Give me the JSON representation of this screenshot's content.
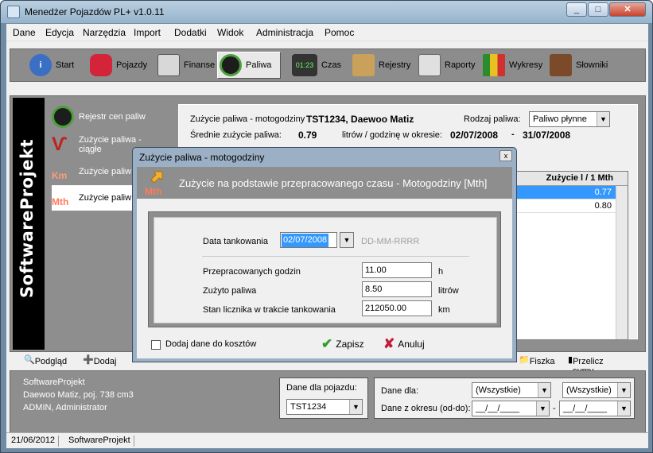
{
  "window": {
    "title": "Menedżer Pojazdów PL+  v1.0.11"
  },
  "menu": [
    "Dane",
    "Edycja",
    "Narzędzia",
    "Import",
    "Dodatki",
    "Widok",
    "Administracja",
    "Pomoc"
  ],
  "toolbar": [
    "Start",
    "Pojazdy",
    "Finanse",
    "Paliwa",
    "Czas",
    "Rejestry",
    "Raporty",
    "Wykresy",
    "Słowniki"
  ],
  "brand": "SoftwareProjekt",
  "subnav": [
    "Rejestr cen paliw",
    "Zużycie paliwa - ciągłe",
    "Zużycie paliw",
    "Zużycie paliw"
  ],
  "subnav_badges": {
    "km": "Km",
    "mth": "Mth"
  },
  "panel": {
    "title_prefix": "Zużycie paliwa - motogodziny",
    "vehicle": "TST1234, Daewoo Matiz",
    "fuel_kind_label": "Rodzaj paliwa:",
    "fuel_kind_value": "Paliwo płynne",
    "avg_label": "Średnie zużycie paliwa:",
    "avg_value": "0.79",
    "avg_unit": "litrów / godzinę  w okresie:",
    "date_from": "02/07/2008",
    "dash": "-",
    "date_to": "31/07/2008"
  },
  "grid": {
    "header": "Zużycie l / 1 Mth",
    "rows": [
      "0.77",
      "0.80"
    ]
  },
  "bottom_toolbar": {
    "preview": "Podgląd",
    "add": "Dodaj",
    "card": "Fiszka",
    "recalc": "Przelicz sumy"
  },
  "info": {
    "company": "SoftwareProjekt",
    "vehicle": "Daewoo Matiz, poj. 738 cm3",
    "user": "ADMIN, Administrator",
    "vehicle_group_label": "Dane dla pojazdu:",
    "vehicle_value": "TST1234",
    "data_for_label": "Dane dla:",
    "data_for_1": "(Wszystkie)",
    "data_for_2": "(Wszystkie)",
    "period_label": "Dane z okresu (od-do):",
    "period_from": "__/__/____",
    "period_dash": "-",
    "period_to": "__/__/____"
  },
  "status": {
    "date": "21/06/2012",
    "company": "SoftwareProjekt"
  },
  "dialog": {
    "title": "Zużycie paliwa - motogodziny",
    "close": "x",
    "header": "Zużycie na podstawie przepracowanego czasu - Motogodziny [Mth]",
    "badge": "Mth",
    "date_label": "Data tankowania",
    "date_value": "02/07/2008",
    "date_format": "DD-MM-RRRR",
    "hours_label": "Przepracowanych godzin",
    "hours_value": "11.00",
    "hours_unit": "h",
    "fuel_label": "Zużyto paliwa",
    "fuel_value": "8.50",
    "fuel_unit": "litrów",
    "counter_label": "Stan licznika w trakcie tankowania",
    "counter_value": "212050.00",
    "counter_unit": "km",
    "add_costs_label": "Dodaj dane do kosztów",
    "save": "Zapisz",
    "cancel": "Anuluj"
  },
  "icons": [
    "info-icon",
    "car-icon",
    "finance-icon",
    "gauge-icon",
    "clock-icon",
    "registers-icon",
    "printer-icon",
    "chart-icon",
    "books-icon",
    "check-icon",
    "cross-icon"
  ]
}
